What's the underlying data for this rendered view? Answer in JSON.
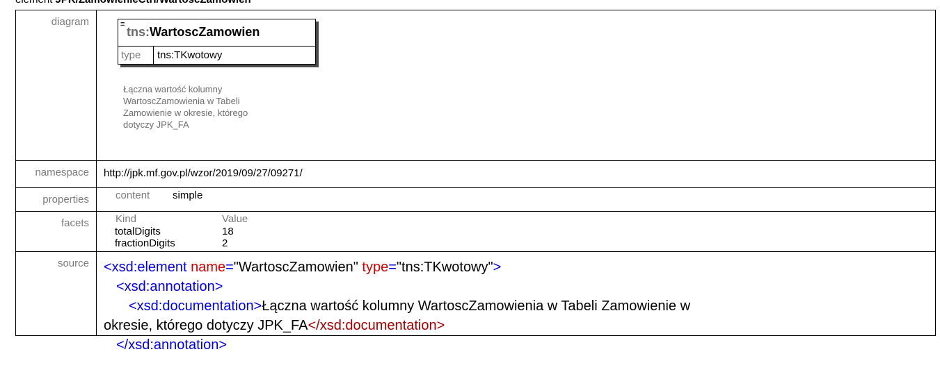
{
  "heading": {
    "prefix": "element ",
    "path": "JPK/ZamowienieCtrl/WartoscZamowien"
  },
  "labels": {
    "diagram": "diagram",
    "namespace": "namespace",
    "properties": "properties",
    "facets": "facets",
    "source": "source"
  },
  "diagram": {
    "prefix": "tns:",
    "name": "WartoscZamowien",
    "type_label": "type",
    "type_value": "tns:TKwotowy",
    "doc_lines": [
      "Łączna wartość kolumny",
      "WartoscZamowienia w Tabeli",
      "Zamowienie w okresie, którego",
      "dotyczy JPK_FA"
    ]
  },
  "namespace": "http://jpk.mf.gov.pl/wzor/2019/09/27/09271/",
  "properties": {
    "key": "content",
    "value": "simple"
  },
  "facets": {
    "header": {
      "kind": "Kind",
      "value": "Value"
    },
    "rows": [
      {
        "kind": "totalDigits",
        "value": "18"
      },
      {
        "kind": "fractionDigits",
        "value": "2"
      }
    ]
  },
  "source": {
    "l1_tag": "<xsd:element",
    "l1_attr1": "name",
    "l1_val1": "\"WartoscZamowien\"",
    "l1_attr2": "type",
    "l1_val2": "\"tns:TKwotowy\"",
    "l1_end": ">",
    "l2": "<xsd:annotation>",
    "l3_tag": "<xsd:documentation>",
    "l3_text": "Łączna wartość kolumny WartoscZamowienia w Tabeli Zamowienie w",
    "l4_text": "okresie, którego dotyczy JPK_FA",
    "l4_close": "</xsd:documentation>",
    "l5": "</xsd:annotation>"
  }
}
